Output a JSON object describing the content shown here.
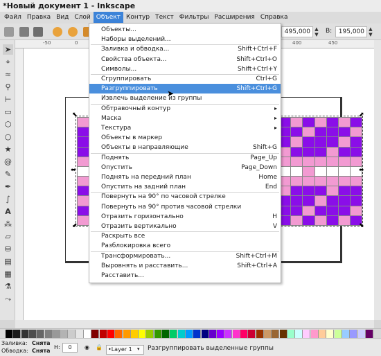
{
  "window": {
    "title": "*Новый документ 1 - Inkscape"
  },
  "menubar": {
    "items": [
      "Файл",
      "Правка",
      "Вид",
      "Слой",
      "Объект",
      "Контур",
      "Текст",
      "Фильтры",
      "Расширения",
      "Справка"
    ]
  },
  "toolbar": {
    "x_value": "495,000",
    "w_label": "В:",
    "w_value": "195,000"
  },
  "ruler": {
    "ticks": [
      "-50",
      "0",
      "400",
      "450"
    ]
  },
  "object_menu": {
    "items": [
      {
        "label": "Объекты...",
        "accel": ""
      },
      {
        "label": "Наборы выделений...",
        "accel": ""
      },
      {
        "label": "Заливка и обводка...",
        "accel": "Shift+Ctrl+F"
      },
      {
        "label": "Свойства объекта...",
        "accel": "Shift+Ctrl+O"
      },
      {
        "label": "Символы...",
        "accel": "Shift+Ctrl+Y"
      },
      {
        "label": "Сгруппировать",
        "accel": "Ctrl+G"
      },
      {
        "label": "Разгруппировать",
        "accel": "Shift+Ctrl+G"
      },
      {
        "label": "Извлечь выделение из группы",
        "accel": ""
      },
      {
        "label": "Обтравочный контур",
        "accel": ""
      },
      {
        "label": "Маска",
        "accel": ""
      },
      {
        "label": "Текстура",
        "accel": ""
      },
      {
        "label": "Объекты в маркер",
        "accel": ""
      },
      {
        "label": "Объекты в направляющие",
        "accel": "Shift+G"
      },
      {
        "label": "Поднять",
        "accel": "Page_Up"
      },
      {
        "label": "Опустить",
        "accel": "Page_Down"
      },
      {
        "label": "Поднять на передний план",
        "accel": "Home"
      },
      {
        "label": "Опустить на задний план",
        "accel": "End"
      },
      {
        "label": "Повернуть на 90° по часовой стрелке",
        "accel": ""
      },
      {
        "label": "Повернуть на 90° против часовой стрелки",
        "accel": ""
      },
      {
        "label": "Отразить горизонтально",
        "accel": "H"
      },
      {
        "label": "Отразить вертикально",
        "accel": "V"
      },
      {
        "label": "Раскрыть все",
        "accel": ""
      },
      {
        "label": "Разблокировка всего",
        "accel": ""
      },
      {
        "label": "Трансформировать...",
        "accel": "Shift+Ctrl+M"
      },
      {
        "label": "Выровнять и расставить...",
        "accel": "Shift+Ctrl+A"
      },
      {
        "label": "Расставить...",
        "accel": ""
      }
    ],
    "highlighted_index": 6,
    "submenu_indices": [
      8,
      9,
      10
    ]
  },
  "statusbar": {
    "fill_label": "Заливка:",
    "fill_value": "Снята",
    "stroke_label": "Обводка:",
    "stroke_value": "Снята",
    "h_label": "Н:",
    "h_value": "0",
    "layer": "•Layer 1",
    "message": "Разгруппировать выделенные группы"
  },
  "colors": {
    "accent": "#4a8fdd",
    "pattern_purple": "#8a0ee8",
    "pattern_pink": "#f29ad2"
  }
}
